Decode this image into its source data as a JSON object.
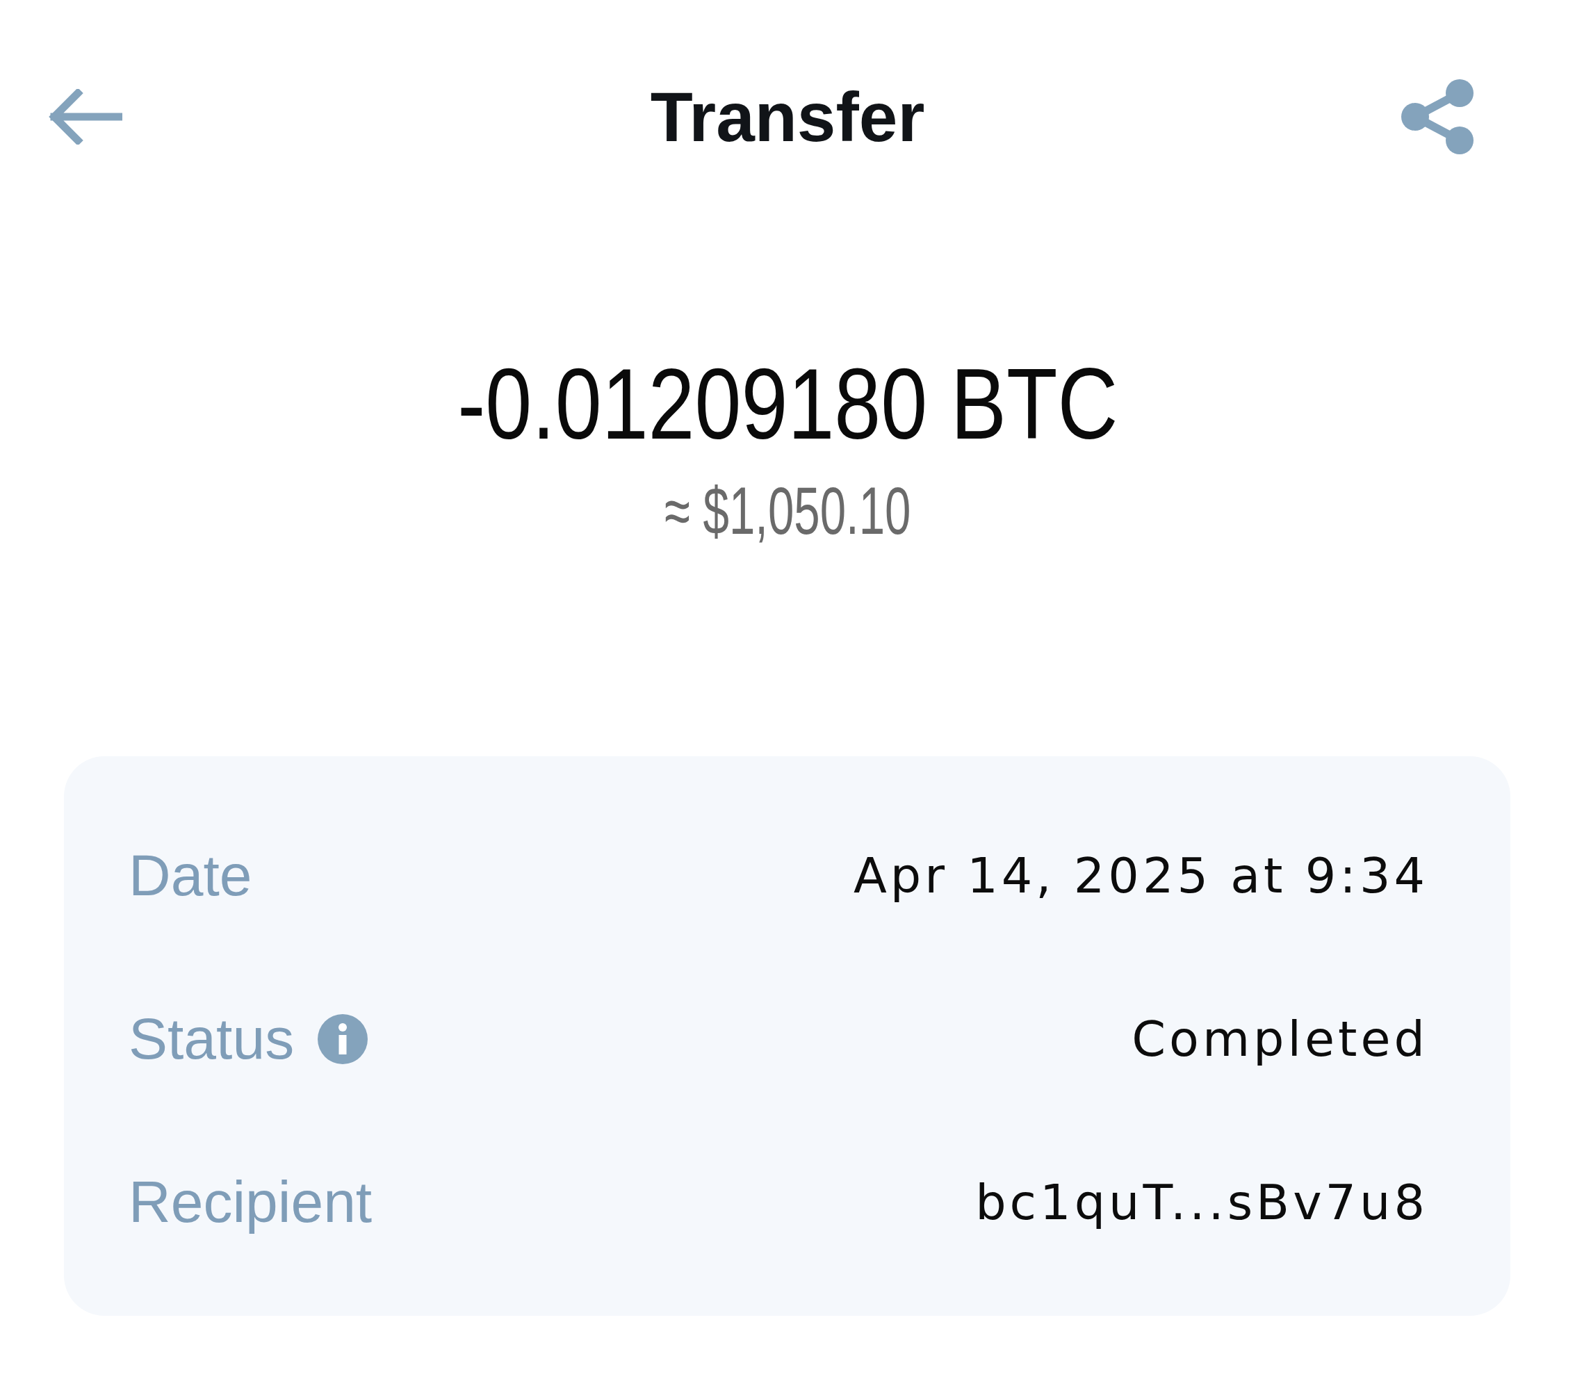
{
  "header": {
    "title": "Transfer"
  },
  "amount": {
    "crypto": "-0.01209180 BTC",
    "fiat": "≈ $1,050.10"
  },
  "details": [
    {
      "label": "Date",
      "value": "Apr 14, 2025 at 9:34",
      "info_icon": false
    },
    {
      "label": "Status",
      "value": "Completed",
      "info_icon": true
    },
    {
      "label": "Recipient",
      "value": "bc1quT...sBv7u8",
      "info_icon": false
    }
  ]
}
